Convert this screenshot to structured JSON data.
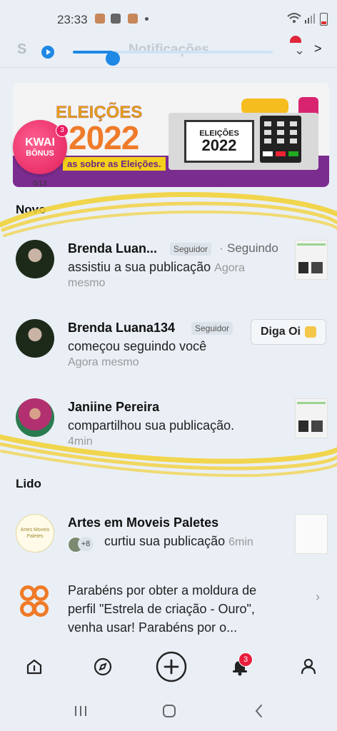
{
  "status_bar": {
    "time": "23:33"
  },
  "header": {
    "title_letter": "S",
    "title_faint": "Notificações"
  },
  "player": {
    "progress": 0.2
  },
  "banner": {
    "kwai_title": "KWAI",
    "kwai_sub": "BÔNUS",
    "kwai_badge": "3",
    "kwai_counter": "0/13",
    "title": "ELEIÇÕES",
    "year": "2022",
    "tagline": "as sobre as Eleições.",
    "screen_line1": "ELEIÇÕES",
    "screen_line2": "2022"
  },
  "sections": {
    "new": "Novo",
    "read": "Lido"
  },
  "notifications_new": [
    {
      "name": "Brenda Luan...",
      "tag": "Seguidor",
      "status": "Seguindo",
      "action": "assistiu a sua publicação",
      "time_inline": "Agora",
      "time": "mesmo"
    },
    {
      "name": "Brenda Luana134",
      "tag": "Seguidor",
      "button": "Diga Oi",
      "action": "começou seguindo você",
      "time": "Agora mesmo"
    },
    {
      "name": "Janiine Pereira",
      "action": "compartilhou sua publicação.",
      "time": "4min"
    }
  ],
  "notifications_read": [
    {
      "name": "Artes em Moveis Paletes",
      "avatar_text": "Artes Moveis Paletes",
      "extra_count": "+8",
      "action": "curtiu sua publicação",
      "time": "6min"
    },
    {
      "message_line1": "Parabéns por obter a moldura de",
      "message_line2": "perfil \"Estrela de criação - Ouro\",",
      "message_line3": "venha usar! Parabéns por o..."
    }
  ],
  "tabbar": {
    "notif_badge": "3"
  },
  "colors": {
    "accent": "#1e88e5",
    "badge": "#e91e3c",
    "kwai_orange": "#f07a27",
    "scribble": "#f2d13a"
  }
}
